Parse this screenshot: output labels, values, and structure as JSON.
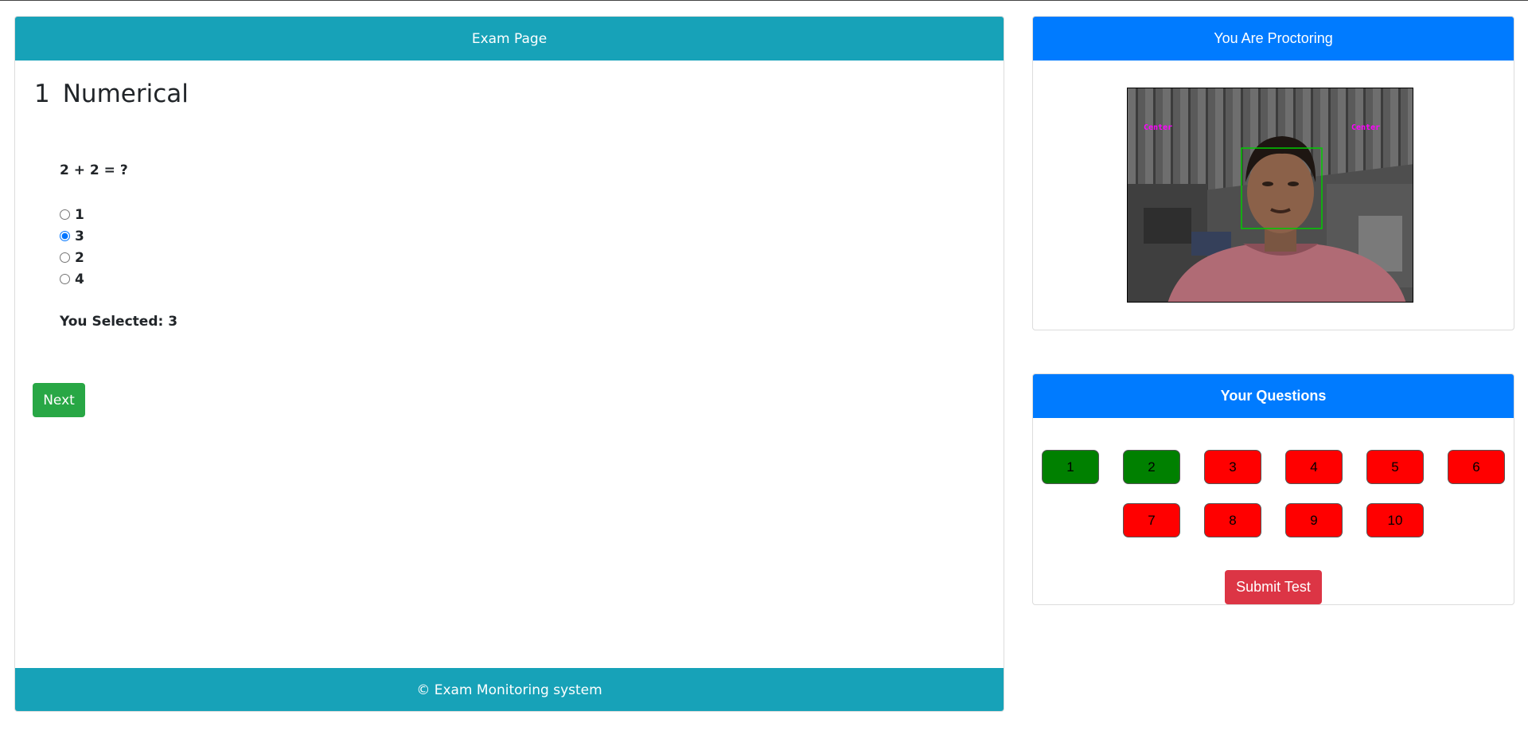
{
  "exam": {
    "header": "Exam Page",
    "question_number": "1",
    "question_category": "Numerical",
    "question_text": "2 + 2 = ?",
    "options": [
      {
        "label": "1",
        "checked": false
      },
      {
        "label": "3",
        "checked": true
      },
      {
        "label": "2",
        "checked": false
      },
      {
        "label": "4",
        "checked": false
      }
    ],
    "selected_text": "You Selected: 3",
    "next_label": "Next",
    "footer": "© Exam Monitoring system"
  },
  "proctor": {
    "header": "You Are Proctoring",
    "webcam_label_left": "Center",
    "webcam_label_right": "Center",
    "face_box_color": "#00cc00"
  },
  "questions": {
    "header": "Your Questions",
    "items": [
      {
        "label": "1",
        "status": "answered"
      },
      {
        "label": "2",
        "status": "answered"
      },
      {
        "label": "3",
        "status": "unanswered"
      },
      {
        "label": "4",
        "status": "unanswered"
      },
      {
        "label": "5",
        "status": "unanswered"
      },
      {
        "label": "6",
        "status": "unanswered"
      },
      {
        "label": "7",
        "status": "unanswered"
      },
      {
        "label": "8",
        "status": "unanswered"
      },
      {
        "label": "9",
        "status": "unanswered"
      },
      {
        "label": "10",
        "status": "unanswered"
      }
    ],
    "submit_label": "Submit Test"
  },
  "colors": {
    "exam_header": "#17a2b8",
    "proctor_header": "#007bff",
    "answered": "#008000",
    "unanswered": "#ff0000",
    "next_button": "#28a745",
    "submit_button": "#dc3545"
  }
}
